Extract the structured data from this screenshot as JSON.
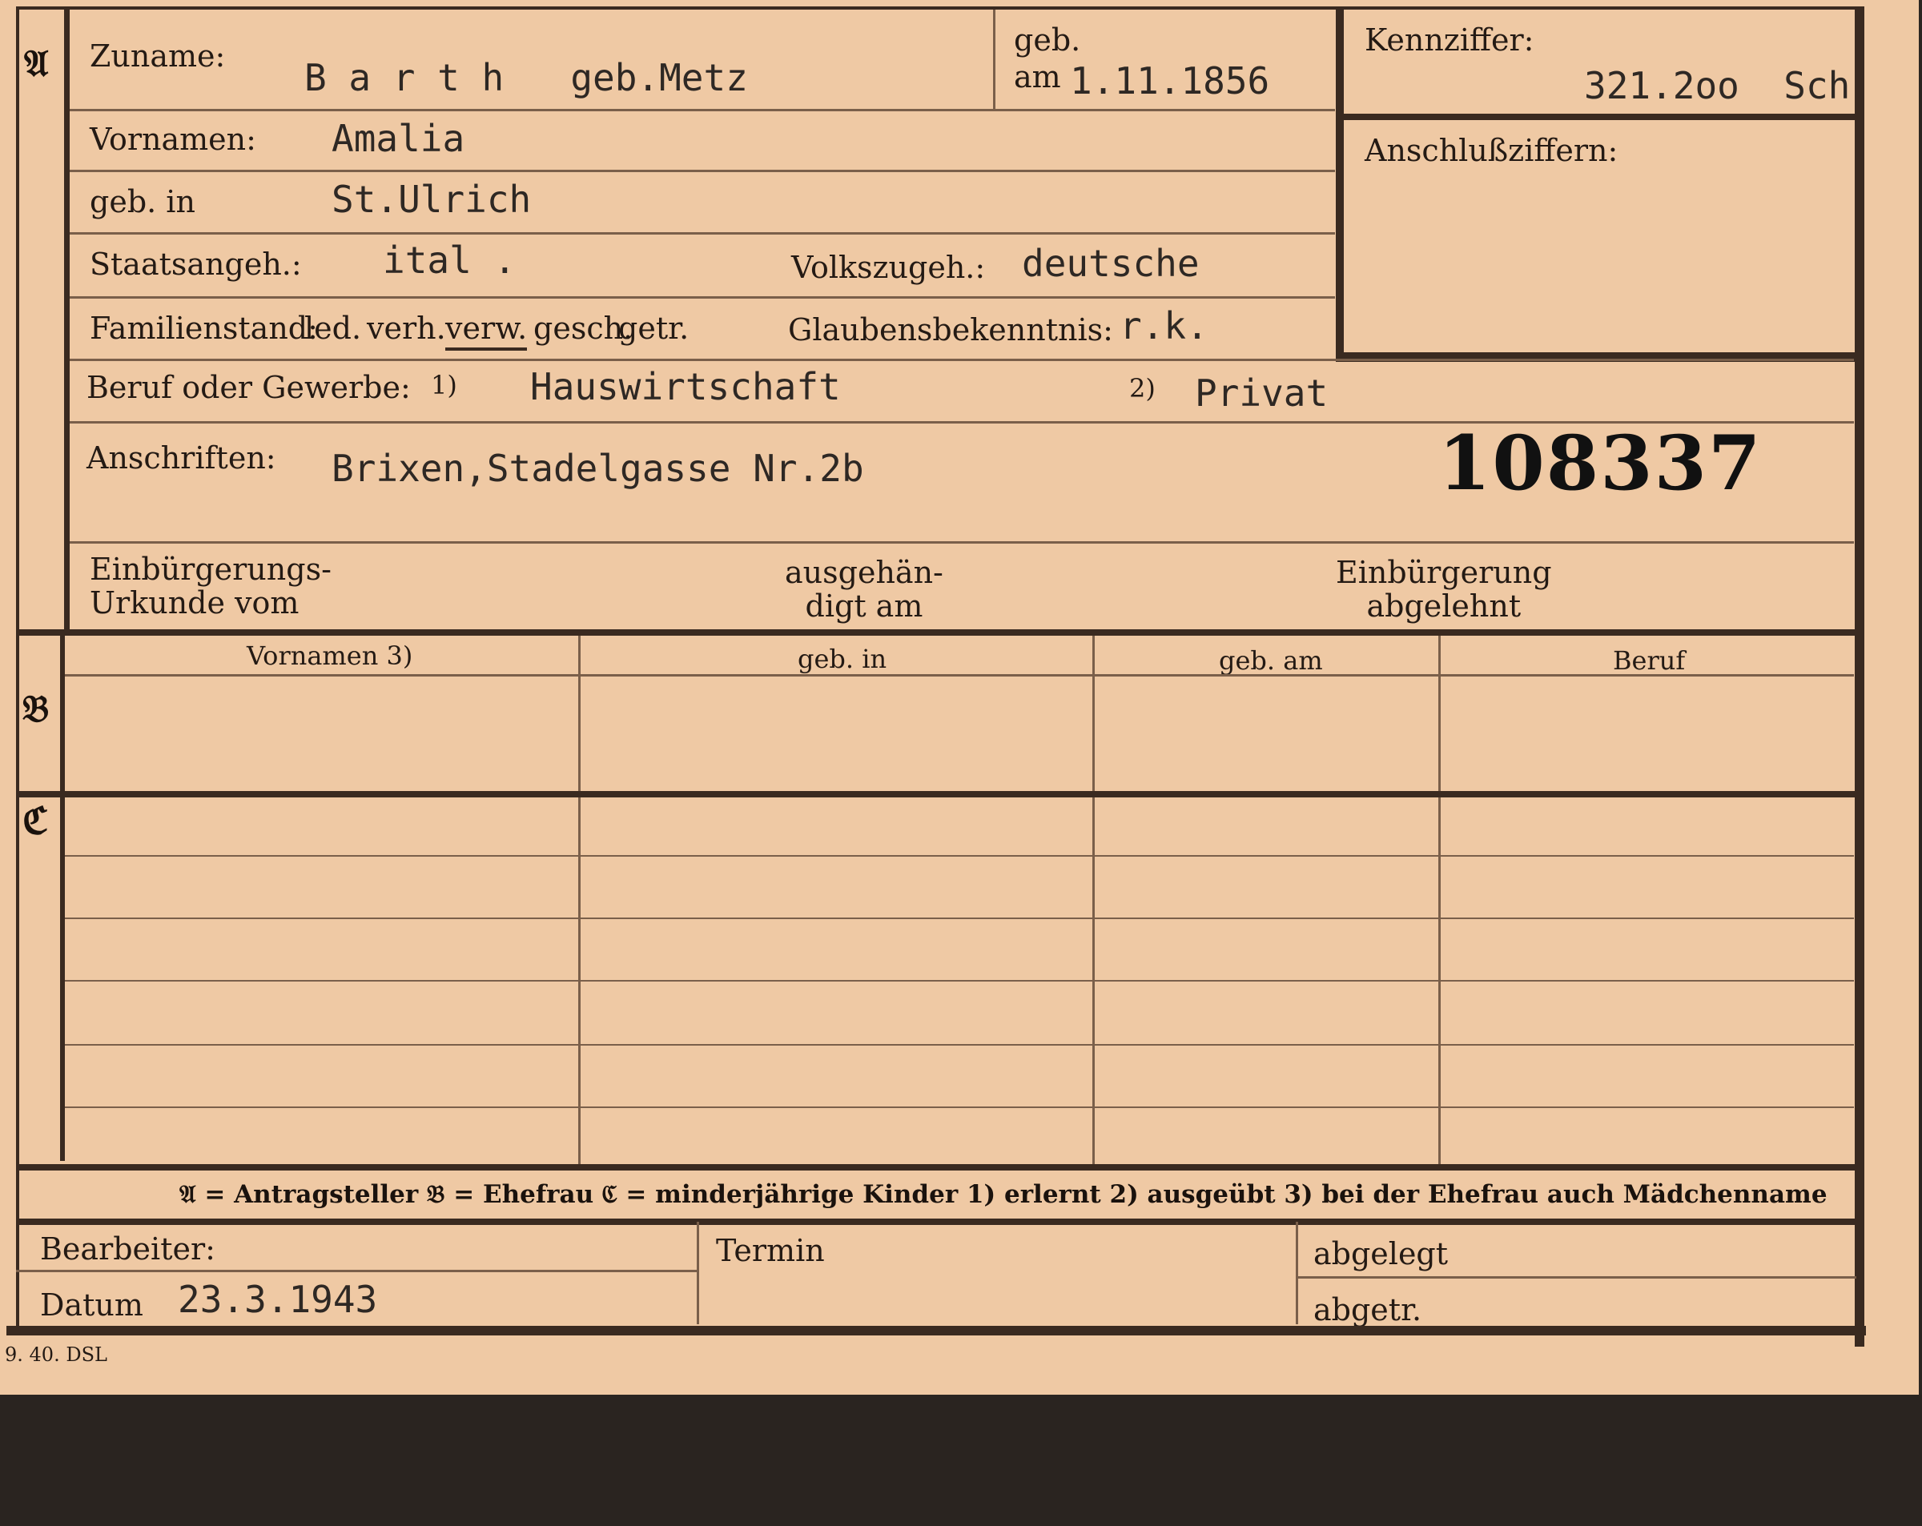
{
  "sections": {
    "a": "𝔄",
    "b": "𝔅",
    "c": "ℭ"
  },
  "fields": {
    "zuname_label": "Zuname:",
    "zuname_value": "B a r t h   geb.Metz",
    "geb_label": "geb.",
    "am_label": "am",
    "geb_am_value": "1.11.1856",
    "kennziffer_label": "Kennziffer:",
    "kennziffer_value": "321.2oo  Sch",
    "anschlussziffern_label": "Anschlußziffern:",
    "vornamen_label": "Vornamen:",
    "vornamen_value": "Amalia",
    "geb_in_label": "geb. in",
    "geb_in_value": "St.Ulrich",
    "staatsangeh_label": "Staatsangeh.:",
    "staatsangeh_value": "ital .",
    "volkszugeh_label": "Volkszugeh.:",
    "volkszugeh_value": "deutsche",
    "familienstand_label": "Familienstand:",
    "familienstand_options": [
      "led.",
      "verh.",
      "verw.",
      "gesch.",
      "getr."
    ],
    "familienstand_selected": "verw.",
    "glaubensbekenntnis_label": "Glaubensbekenntnis:",
    "glaubensbekenntnis_value": "r.k.",
    "beruf_label": "Beruf oder Gewerbe:",
    "beruf_note1": "1)",
    "beruf_value1": "Hauswirtschaft",
    "beruf_note2": "2)",
    "beruf_value2": "Privat",
    "anschriften_label": "Anschriften:",
    "anschriften_value": "Brixen,Stadelgasse Nr.2b",
    "stamp_number": "108337",
    "einbuergerung_urkunde_label": "Einbürgerungs-\nUrkunde vom",
    "ausgehaendigt_label": "ausgehän-\ndigt am",
    "einbuergerung_abgelehnt_label": "Einbürgerung\nabgelehnt"
  },
  "table": {
    "columns": [
      "Vornamen 3)",
      "geb. in",
      "geb. am",
      "Beruf"
    ]
  },
  "legend": "𝔄 = Antragsteller   𝔅 = Ehefrau   ℭ = minderjährige Kinder   1) erlernt   2) ausgeübt   3) bei der Ehefrau auch Mädchenname",
  "footer": {
    "bearbeiter_label": "Bearbeiter:",
    "datum_label": "Datum",
    "datum_value": "23.3.1943",
    "termin_label": "Termin",
    "abgelegt_label": "abgelegt",
    "abgetr_label": "abgetr.",
    "print_code": "9. 40. DSL"
  }
}
